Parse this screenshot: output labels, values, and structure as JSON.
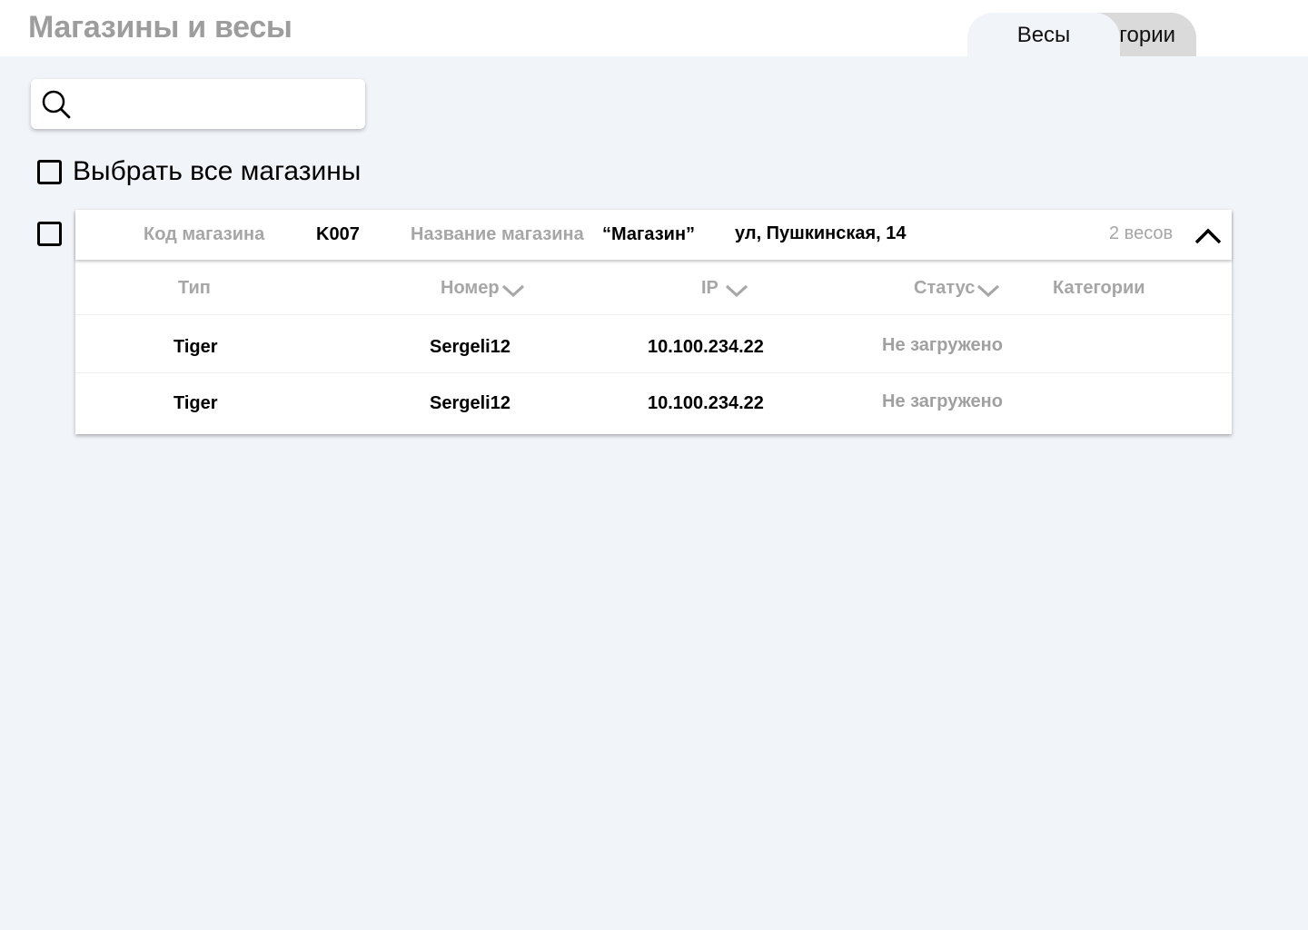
{
  "header": {
    "title": "Магазины и весы",
    "tabs": [
      {
        "label": "Весы",
        "active": true
      },
      {
        "label": "Категории",
        "visible_text": "гории",
        "active": false
      }
    ]
  },
  "search": {
    "placeholder": "",
    "value": ""
  },
  "select_all": {
    "label": "Выбрать все магазины",
    "checked": false
  },
  "store": {
    "checked": false,
    "code_label": "Код магазина",
    "code": "K007",
    "name_label": "Название магазина",
    "name": "“Магазин”",
    "address": "ул, Пушкинская, 14",
    "scales_count": "2 весов",
    "expanded": true
  },
  "table": {
    "columns": [
      "Тип",
      "Номер",
      "IP",
      "Статус",
      "Категории"
    ],
    "rows": [
      {
        "type": "Tiger",
        "number": "Sergeli12",
        "ip": "10.100.234.22",
        "status": "Не загружено",
        "categories": ""
      },
      {
        "type": "Tiger",
        "number": "Sergeli12",
        "ip": "10.100.234.22",
        "status": "Не загружено",
        "categories": ""
      }
    ]
  },
  "icons": [
    "search-icon",
    "checkbox",
    "chevron-up-icon",
    "chevron-down-icon"
  ]
}
